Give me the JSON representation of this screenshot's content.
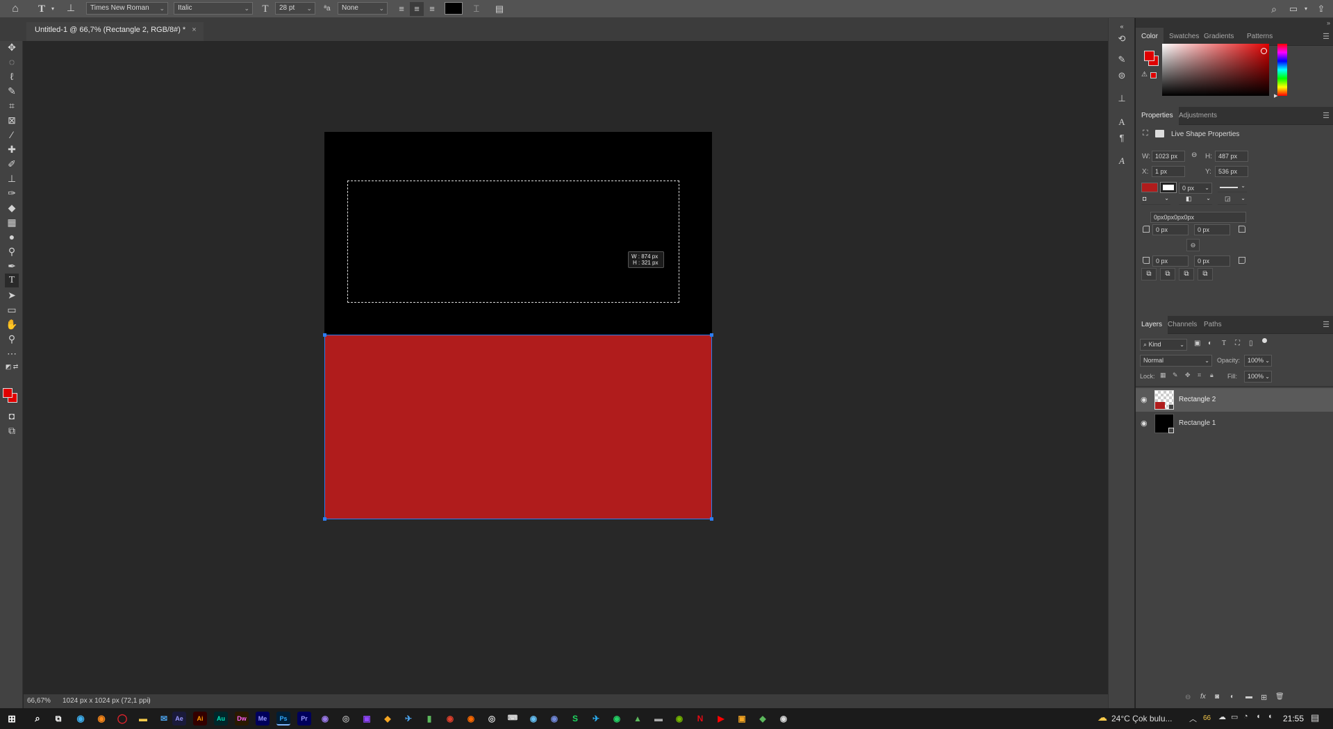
{
  "options_bar": {
    "font_family": "Times New Roman",
    "font_style": "Italic",
    "font_size": "28 pt",
    "antialias": "None"
  },
  "document_tab": {
    "title": "Untitled-1 @ 66,7% (Rectangle 2, RGB/8#) *",
    "close": "×"
  },
  "canvas": {
    "selection_tooltip_w": "W :  874 px",
    "selection_tooltip_h": "H :  321 px",
    "rect1_color": "#000000",
    "rect2_color": "#b01c1c"
  },
  "color_panel": {
    "tabs": [
      "Color",
      "Swatches",
      "Gradients",
      "Patterns"
    ],
    "foreground": "#e00000",
    "background": "#e00000"
  },
  "properties_panel": {
    "tabs": [
      "Properties",
      "Adjustments"
    ],
    "section_title": "Live Shape Properties",
    "w_label": "W:",
    "w_value": "1023 px",
    "h_label": "H:",
    "h_value": "487 px",
    "x_label": "X:",
    "x_value": "1 px",
    "y_label": "Y:",
    "y_value": "536 px",
    "stroke_width": "0 px",
    "corner_radii": "0px0px0px0px",
    "corner_tl": "0 px",
    "corner_tr": "0 px",
    "corner_bl": "0 px",
    "corner_br": "0 px",
    "fill_color": "#b01c1c"
  },
  "layers_panel": {
    "tabs": [
      "Layers",
      "Channels",
      "Paths"
    ],
    "filter_kind": "Kind",
    "blend_mode": "Normal",
    "opacity_label": "Opacity:",
    "opacity_value": "100%",
    "lock_label": "Lock:",
    "fill_label": "Fill:",
    "fill_value": "100%",
    "layers": [
      {
        "name": "Rectangle 2",
        "selected": true
      },
      {
        "name": "Rectangle 1",
        "selected": false
      }
    ]
  },
  "status_bar": {
    "zoom": "66,67%",
    "doc_info": "1024 px x 1024 px (72,1 ppi)"
  },
  "taskbar": {
    "weather": "24°C  Çok bulu...",
    "notif_count": "66",
    "clock": "21:55"
  }
}
